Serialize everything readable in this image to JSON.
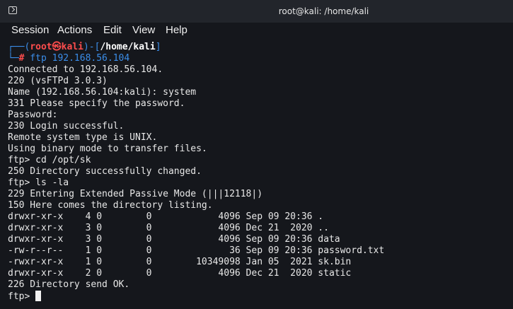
{
  "window": {
    "title": "root@kali: /home/kali"
  },
  "menu": [
    "Session",
    "Actions",
    "Edit",
    "View",
    "Help"
  ],
  "prompt": {
    "corner_top": "┌──(",
    "user": "root",
    "at_symbol": "㉿",
    "host": "kali",
    "path_open": ")-[",
    "path": "/home/kali",
    "path_close": "]",
    "corner_bottom": "└─",
    "hash": "#",
    "command": " ftp 192.168.56.104"
  },
  "output": [
    "Connected to 192.168.56.104.",
    "220 (vsFTPd 3.0.3)",
    "Name (192.168.56.104:kali): system",
    "331 Please specify the password.",
    "Password:",
    "230 Login successful.",
    "Remote system type is UNIX.",
    "Using binary mode to transfer files.",
    "ftp> cd /opt/sk",
    "250 Directory successfully changed.",
    "ftp> ls -la",
    "229 Entering Extended Passive Mode (|||12118|)",
    "150 Here comes the directory listing.",
    "drwxr-xr-x    4 0        0            4096 Sep 09 20:36 .",
    "drwxr-xr-x    3 0        0            4096 Dec 21  2020 ..",
    "drwxr-xr-x    3 0        0            4096 Sep 09 20:36 data",
    "-rw-r--r--    1 0        0              36 Sep 09 20:36 password.txt",
    "-rwxr-xr-x    1 0        0        10349098 Jan 05  2021 sk.bin",
    "drwxr-xr-x    2 0        0            4096 Dec 21  2020 static",
    "226 Directory send OK."
  ],
  "final_prompt": "ftp> "
}
